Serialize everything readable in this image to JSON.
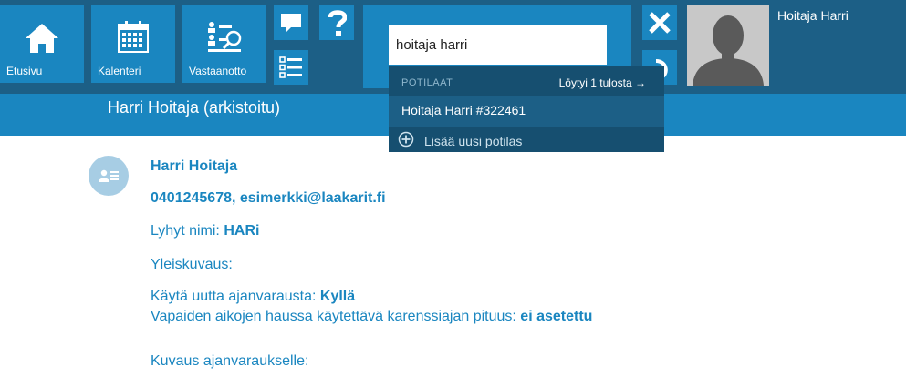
{
  "nav": {
    "home_label": "Etusivu",
    "calendar_label": "Kalenteri",
    "reception_label": "Vastaanotto"
  },
  "search": {
    "value": "hoitaja harri"
  },
  "user": {
    "name": "Hoitaja Harri"
  },
  "patient_header": {
    "title": "Harri Hoitaja (arkistoitu)"
  },
  "dropdown": {
    "category": "POTILAAT",
    "count_text": "Löytyi 1 tulosta →",
    "result": "Hoitaja Harri #322461",
    "add_label": "Lisää uusi potilas"
  },
  "patient": {
    "name": "Harri Hoitaja",
    "contact": "0401245678, esimerkki@laakarit.fi",
    "short_name_label": "Lyhyt nimi: ",
    "short_name_value": "HARi",
    "general_label": "Yleiskuvaus:",
    "new_booking_label": "Käytä uutta ajanvarausta: ",
    "new_booking_value": "Kyllä",
    "grace_label": "Vapaiden aikojen haussa käytettävä karenssiajan pituus: ",
    "grace_value": "ei asetettu",
    "booking_desc_label": "Kuvaus ajanvaraukselle:"
  },
  "colors": {
    "topbar": "#1c5f86",
    "tile": "#1a86c0",
    "accent_text": "#1a86c0",
    "dropdown_dark": "#164f70"
  }
}
